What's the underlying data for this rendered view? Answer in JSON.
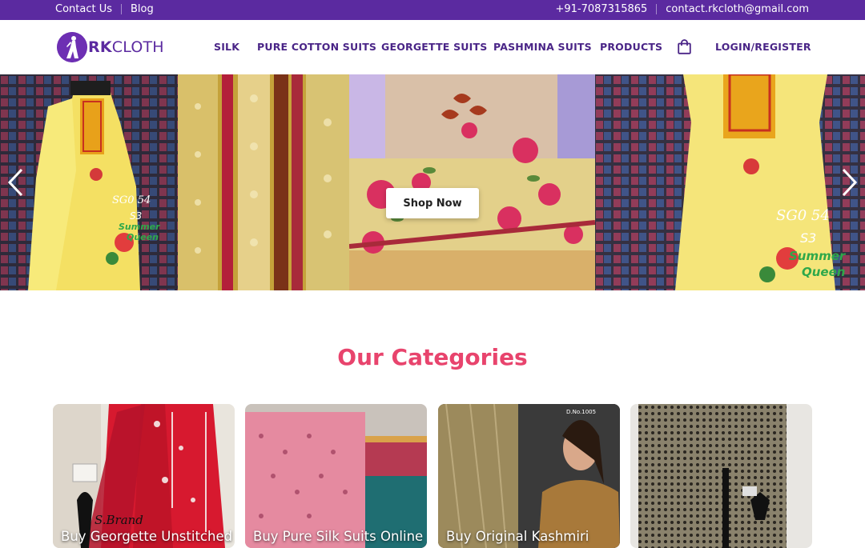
{
  "topbar": {
    "contact_label": "Contact Us",
    "blog_label": "Blog",
    "phone": "+91-7087315865",
    "email": "contact.rkcloth@gmail.com",
    "background": "#5b2aa0"
  },
  "brand": {
    "name_bold": "RK",
    "name_rest": "CLOTH",
    "color": "#5b2aa0",
    "icon": "woman-silhouette-logo-icon"
  },
  "nav": {
    "items": [
      "SILK",
      "PURE COTTON SUITS",
      "GEORGETTE SUITS",
      "PASHMINA SUITS",
      "PRODUCTS"
    ],
    "cart_icon": "shopping-bag-icon",
    "login_label": "LOGIN/REGISTER"
  },
  "hero": {
    "cta_label": "Shop Now",
    "prev_icon": "chevron-left-icon",
    "next_icon": "chevron-right-icon",
    "overlay_left": {
      "code": "SG0 54",
      "sub": "S3",
      "brand_a": "Summer",
      "brand_b": "Queen"
    },
    "overlay_right": {
      "code": "SG0 54",
      "sub": "S3",
      "brand_a": "Summer",
      "brand_b": "Queen"
    }
  },
  "categories": {
    "title": "Our Categories",
    "title_color": "#e8446d",
    "cards": [
      {
        "label": "Buy Georgette Unstitched",
        "watermark": "S.Brand"
      },
      {
        "label": "Buy Pure Silk Suits Online"
      },
      {
        "label": "Buy Original Kashmiri",
        "tag": "D.No.1005"
      },
      {
        "label": ""
      }
    ]
  }
}
